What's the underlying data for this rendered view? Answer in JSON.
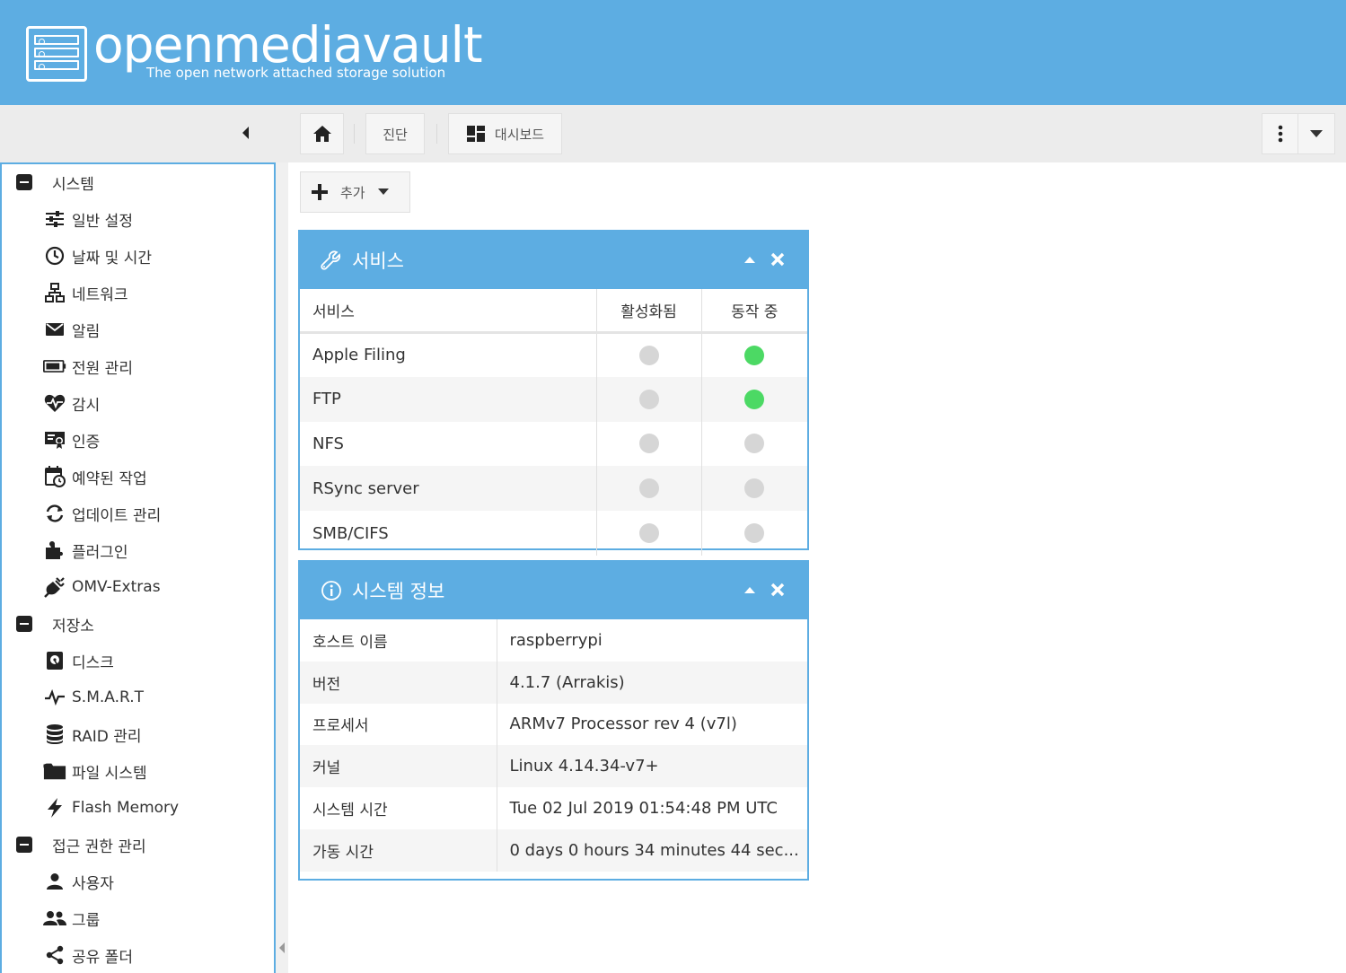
{
  "app": {
    "brand": "openmediavault",
    "tagline": "The open network attached storage solution"
  },
  "colors": {
    "accent": "#5dade2",
    "status_on": "#4cd964",
    "status_off": "#d6d6d6"
  },
  "breadcrumb": {
    "home_icon": "home-icon",
    "crumbs": [
      "진단",
      "대시보드"
    ]
  },
  "toolbar": {
    "add_label": "추가"
  },
  "sidebar": {
    "groups": [
      {
        "label": "시스템",
        "items": [
          {
            "label": "일반 설정",
            "icon": "sliders-icon"
          },
          {
            "label": "날짜 및 시간",
            "icon": "clock-icon"
          },
          {
            "label": "네트워크",
            "icon": "network-icon"
          },
          {
            "label": "알림",
            "icon": "envelope-icon"
          },
          {
            "label": "전원 관리",
            "icon": "battery-icon"
          },
          {
            "label": "감시",
            "icon": "heartbeat-icon"
          },
          {
            "label": "인증",
            "icon": "certificate-icon"
          },
          {
            "label": "예약된 작업",
            "icon": "calendar-clock-icon"
          },
          {
            "label": "업데이트 관리",
            "icon": "refresh-icon"
          },
          {
            "label": "플러그인",
            "icon": "puzzle-icon"
          },
          {
            "label": "OMV-Extras",
            "icon": "plug-icon"
          }
        ]
      },
      {
        "label": "저장소",
        "items": [
          {
            "label": "디스크",
            "icon": "disk-icon"
          },
          {
            "label": "S.M.A.R.T",
            "icon": "pulse-icon"
          },
          {
            "label": "RAID 관리",
            "icon": "database-icon"
          },
          {
            "label": "파일 시스템",
            "icon": "folder-icon"
          },
          {
            "label": "Flash Memory",
            "icon": "flash-icon"
          }
        ]
      },
      {
        "label": "접근 권한 관리",
        "items": [
          {
            "label": "사용자",
            "icon": "user-icon"
          },
          {
            "label": "그룹",
            "icon": "users-icon"
          },
          {
            "label": "공유 폴더",
            "icon": "share-icon"
          }
        ]
      }
    ]
  },
  "services_panel": {
    "title": "서비스",
    "columns": [
      "서비스",
      "활성화됨",
      "동작 중"
    ],
    "rows": [
      {
        "name": "Apple Filing",
        "enabled": false,
        "running": true
      },
      {
        "name": "FTP",
        "enabled": false,
        "running": true
      },
      {
        "name": "NFS",
        "enabled": false,
        "running": false
      },
      {
        "name": "RSync server",
        "enabled": false,
        "running": false
      },
      {
        "name": "SMB/CIFS",
        "enabled": false,
        "running": false
      }
    ]
  },
  "sysinfo_panel": {
    "title": "시스템 정보",
    "rows": [
      {
        "key": "호스트 이름",
        "value": "raspberrypi"
      },
      {
        "key": "버전",
        "value": "4.1.7 (Arrakis)"
      },
      {
        "key": "프로세서",
        "value": "ARMv7 Processor rev 4 (v7l)"
      },
      {
        "key": "커널",
        "value": "Linux 4.14.34-v7+"
      },
      {
        "key": "시스템 시간",
        "value": "Tue 02 Jul 2019 01:54:48 PM UTC"
      },
      {
        "key": "가동 시간",
        "value": "0 days 0 hours 34 minutes 44 sec..."
      }
    ]
  }
}
